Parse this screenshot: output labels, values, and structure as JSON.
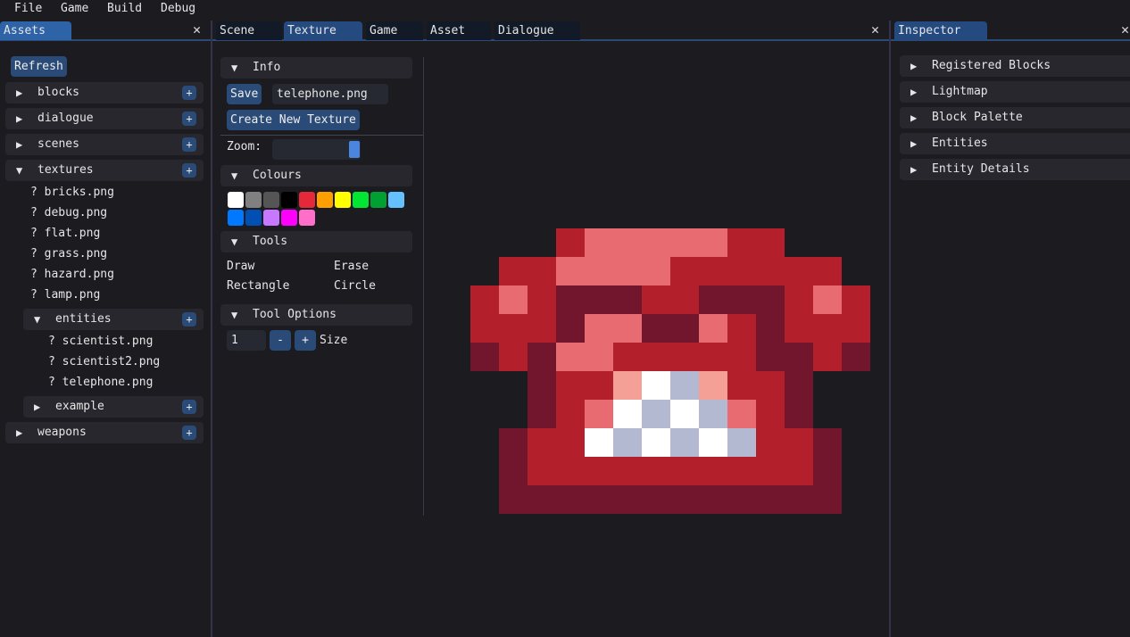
{
  "menu": [
    "File",
    "Game",
    "Build",
    "Debug"
  ],
  "left": {
    "tab": "Assets",
    "refresh": "Refresh",
    "folders": [
      {
        "label": "blocks",
        "open": false
      },
      {
        "label": "dialogue",
        "open": false
      },
      {
        "label": "scenes",
        "open": false
      },
      {
        "label": "textures",
        "open": true
      }
    ],
    "texture_files": [
      "bricks.png",
      "debug.png",
      "flat.png",
      "grass.png",
      "hazard.png",
      "lamp.png"
    ],
    "entities": {
      "label": "entities",
      "files": [
        "scientist.png",
        "scientist2.png",
        "telephone.png"
      ]
    },
    "example": "example",
    "weapons": "weapons",
    "file_icon": "?"
  },
  "center": {
    "tabs": [
      "Scene",
      "Texture",
      "Game",
      "Asset",
      "Dialogue"
    ],
    "active_tab": "Texture",
    "info": "Info",
    "save": "Save",
    "filename": "telephone.png",
    "create": "Create New Texture",
    "zoom_label": "Zoom:",
    "zoom_value": 1.0,
    "colours": "Colours",
    "swatches": [
      "#ffffff",
      "#808080",
      "#555555",
      "#000000",
      "#e6283b",
      "#ffa000",
      "#ffff00",
      "#00e632",
      "#00a032",
      "#64c0ff",
      "#0078ff",
      "#0050b4",
      "#c878ff",
      "#ff00ff",
      "#ff6ec8"
    ],
    "tools": "Tools",
    "tool_list": [
      "Draw",
      "Erase",
      "Rectangle",
      "Circle"
    ],
    "tool_options": "Tool Options",
    "size_value": "1",
    "minus": "-",
    "plus": "+",
    "size_label": "Size"
  },
  "texture": {
    "palette": {
      "R": "#b31f2a",
      "P": "#e96b72",
      "D": "#72162e",
      "W": "#ffffff",
      "B": "#b3b9d1",
      "S": "#f4a097"
    },
    "rows": [
      "...RPPPPPRR...",
      ".RRPPPPRRRRRR.",
      "RPRDDDRRDDDRPR",
      "RRRDPPDDPRDRRR",
      "DRDPPRRRRRDDRD",
      "..DRRSWBSRRD..",
      "..DRPWBWBPRD..",
      ".DRRWBWBWBRRD.",
      ".DRRRRRRRRRRD.",
      ".DDDDDDDDDDDD."
    ]
  },
  "right": {
    "tab": "Inspector",
    "sections": [
      "Registered Blocks",
      "Lightmap",
      "Block Palette",
      "Entities",
      "Entity Details"
    ]
  }
}
